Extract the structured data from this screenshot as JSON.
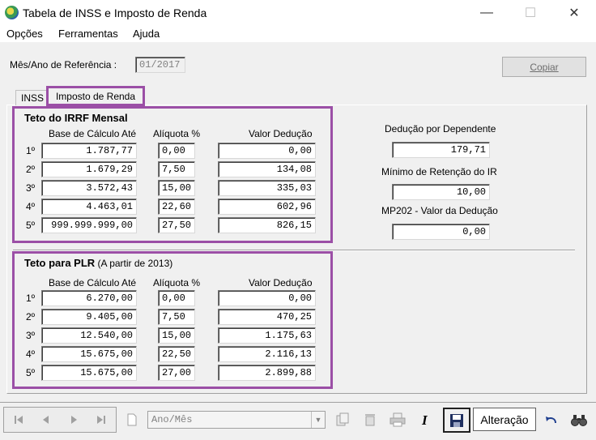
{
  "window": {
    "title": "Tabela de INSS e Imposto de Renda",
    "minimize_glyph": "—",
    "maximize_glyph": "☐",
    "close_glyph": "✕"
  },
  "menu": {
    "items": [
      "Opções",
      "Ferramentas",
      "Ajuda"
    ]
  },
  "reference": {
    "label": "Mês/Ano de Referência :",
    "value": "01/2017"
  },
  "copy_button": "Copiar",
  "tabs": [
    {
      "label": "INSS"
    },
    {
      "label": "Imposto de Renda"
    }
  ],
  "irrf": {
    "title": "Teto do IRRF Mensal",
    "columns": [
      "Base de Cálculo Até",
      "Alíquota %",
      "Valor Dedução"
    ],
    "rows": [
      {
        "label": "1º",
        "base": "1.787,77",
        "aliquota": "0,00",
        "deducao": "0,00"
      },
      {
        "label": "2º",
        "base": "1.679,29",
        "aliquota": "7,50",
        "deducao": "134,08"
      },
      {
        "label": "3º",
        "base": "3.572,43",
        "aliquota": "15,00",
        "deducao": "335,03"
      },
      {
        "label": "4º",
        "base": "4.463,01",
        "aliquota": "22,60",
        "deducao": "602,96"
      },
      {
        "label": "5º",
        "base": "999.999.999,00",
        "aliquota": "27,50",
        "deducao": "826,15"
      }
    ]
  },
  "plr": {
    "title": "Teto para PLR",
    "subtitle": "(A partir de 2013)",
    "columns": [
      "Base de Cálculo Até",
      "Alíquota %",
      "Valor Dedução"
    ],
    "rows": [
      {
        "label": "1º",
        "base": "6.270,00",
        "aliquota": "0,00",
        "deducao": "0,00"
      },
      {
        "label": "2º",
        "base": "9.405,00",
        "aliquota": "7,50",
        "deducao": "470,25"
      },
      {
        "label": "3º",
        "base": "12.540,00",
        "aliquota": "15,00",
        "deducao": "1.175,63"
      },
      {
        "label": "4º",
        "base": "15.675,00",
        "aliquota": "22,50",
        "deducao": "2.116,13"
      },
      {
        "label": "5º",
        "base": "15.675,00",
        "aliquota": "27,00",
        "deducao": "2.899,88"
      }
    ]
  },
  "side": {
    "dependente_label": "Dedução por Dependente",
    "dependente_value": "179,71",
    "minimo_label": "Mínimo de Retenção do IR",
    "minimo_value": "10,00",
    "mp202_label": "MP202 - Valor da Dedução",
    "mp202_value": "0,00"
  },
  "toolbar": {
    "period_placeholder": "Ano/Mês",
    "status": "Alteração"
  },
  "colors": {
    "highlight": "#9b4fa6",
    "background": "#f0f0f0"
  }
}
